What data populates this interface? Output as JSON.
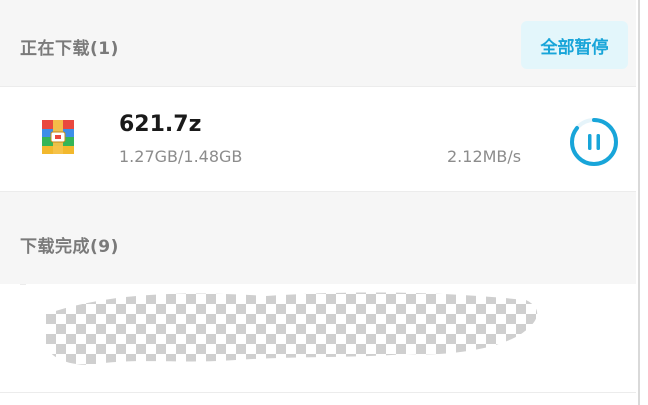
{
  "downloading_section": {
    "title": "正在下载(1)",
    "pause_all_label": "全部暂停"
  },
  "active_download": {
    "file_name": "621.7z",
    "progress_text": "1.27GB/1.48GB",
    "speed": "2.12MB/s",
    "progress_fraction": 0.858,
    "icon": "archive-file-icon",
    "action_icon": "pause-icon"
  },
  "completed_section": {
    "title": "下载完成(9)"
  },
  "colors": {
    "accent": "#18a5d9",
    "accent_bg": "#e3f6fb",
    "header_bg": "#f6f6f6",
    "muted_text": "#8c8c8c"
  }
}
